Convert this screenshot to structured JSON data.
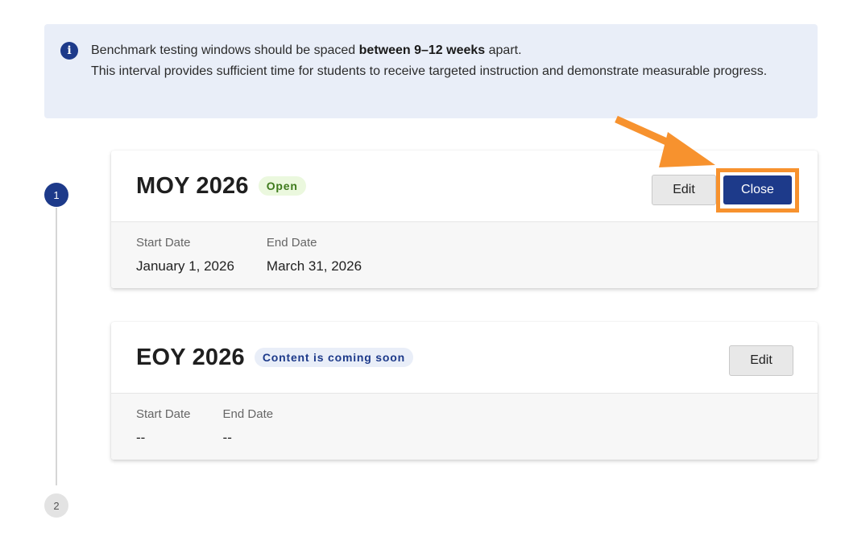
{
  "banner": {
    "icon": "info-icon",
    "line1_prefix": "Benchmark testing windows should be spaced ",
    "line1_bold": "between 9–12 weeks",
    "line1_suffix": " apart.",
    "line2": "This interval provides sufficient time for students to receive targeted instruction and demonstrate measurable progress."
  },
  "stepper": {
    "steps": [
      "1",
      "2"
    ]
  },
  "windows": [
    {
      "title": "MOY 2026",
      "badge": "Open",
      "edit_label": "Edit",
      "close_label": "Close",
      "start_label": "Start Date",
      "start_value": "January 1, 2026",
      "end_label": "End Date",
      "end_value": "March 31, 2026"
    },
    {
      "title": "EOY 2026",
      "badge": "Content is coming soon",
      "edit_label": "Edit",
      "start_label": "Start Date",
      "start_value": "--",
      "end_label": "End Date",
      "end_value": "--"
    }
  ],
  "colors": {
    "primary": "#1d3a8a",
    "banner_bg": "#e9eef8",
    "open_badge_bg": "#ebf8de",
    "open_badge_text": "#3e7a1c",
    "annotation": "#f7922e"
  }
}
